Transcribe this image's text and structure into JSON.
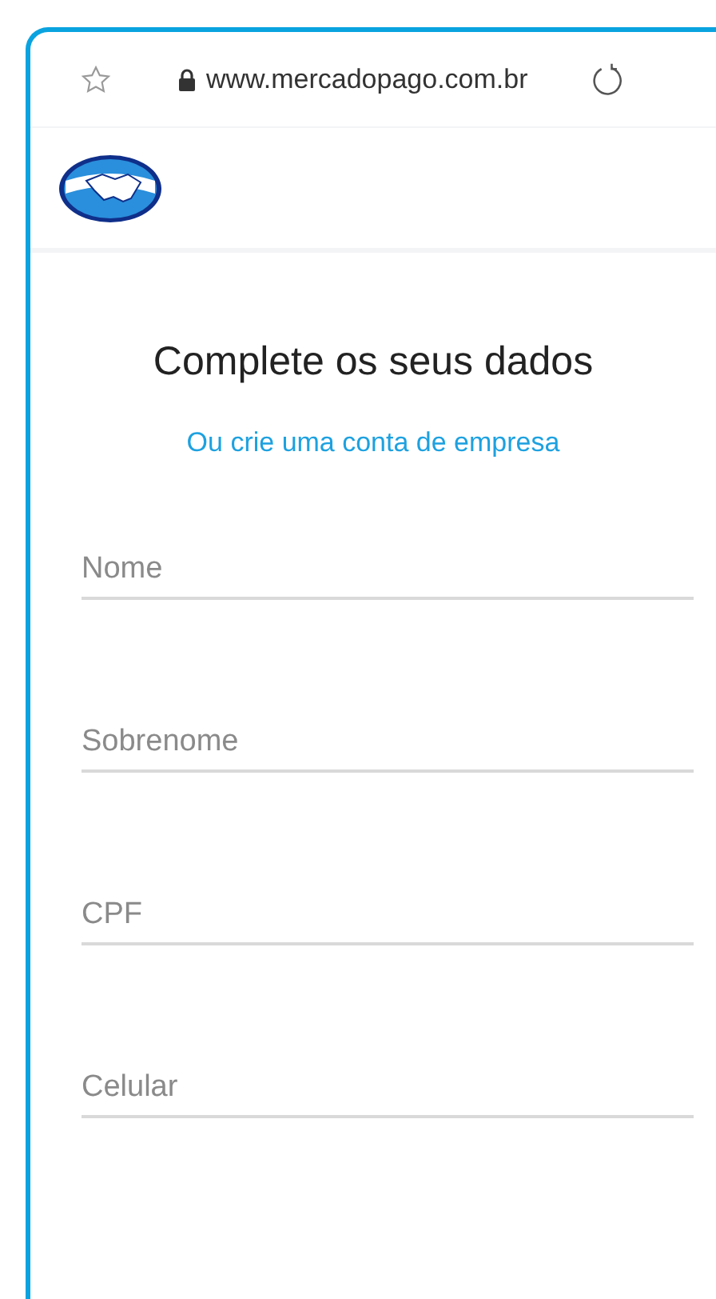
{
  "browser": {
    "url": "www.mercadopago.com.br"
  },
  "form": {
    "title": "Complete os seus dados",
    "link": "Ou crie uma conta de empresa",
    "fields": [
      {
        "placeholder": "Nome"
      },
      {
        "placeholder": "Sobrenome"
      },
      {
        "placeholder": "CPF"
      },
      {
        "placeholder": "Celular"
      }
    ]
  }
}
